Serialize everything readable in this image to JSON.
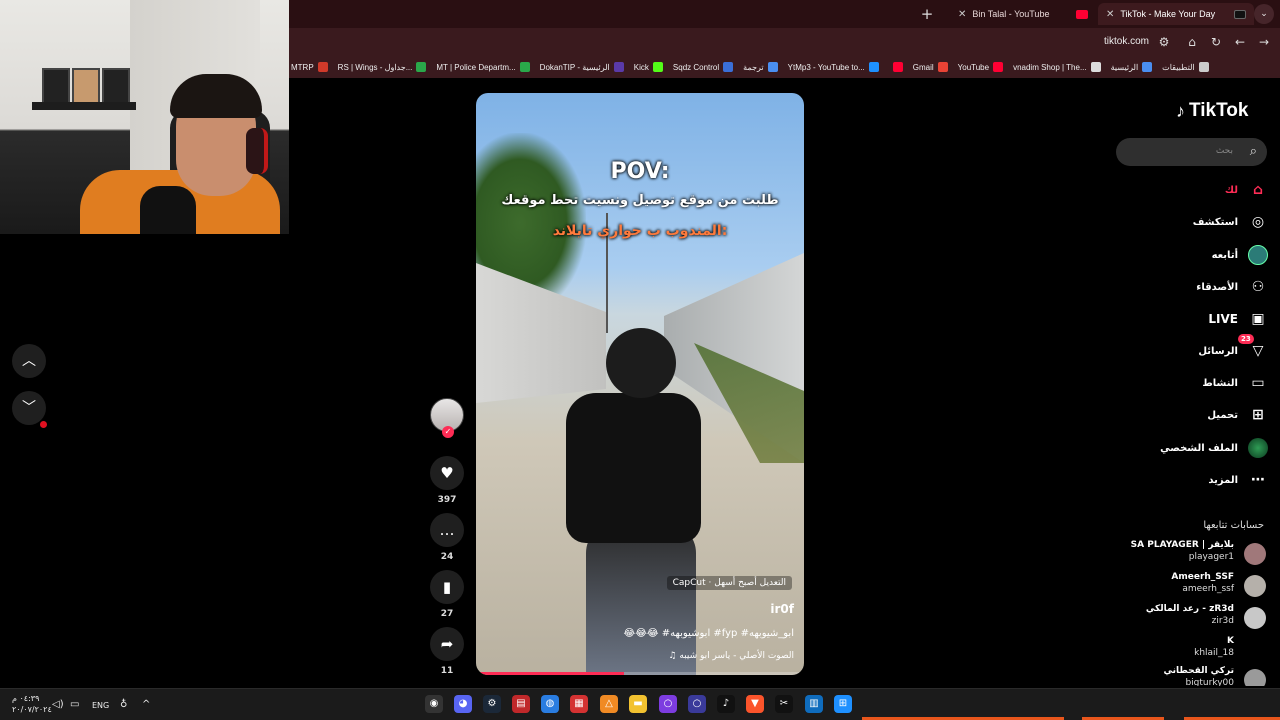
{
  "browser": {
    "tabs": [
      {
        "title": "Bin Talal - YouTube",
        "favicon": "youtube-icon"
      },
      {
        "title": "TikTok - Make Your Day",
        "favicon": "tiktok-icon",
        "active": true
      }
    ],
    "address": "tiktok.com",
    "bookmarks": [
      {
        "label": "MTRP",
        "color": "#d03a2a"
      },
      {
        "label": "RS | Wings - جداول...",
        "color": "#2aa84a"
      },
      {
        "label": "MT | Police Departm...",
        "color": "#2aa84a"
      },
      {
        "label": "DokanTIP - الرئيسية",
        "color": "#5a3aa8"
      },
      {
        "label": "Kick",
        "color": "#53fc18"
      },
      {
        "label": "Sqdz Control",
        "color": "#3a6fd8"
      },
      {
        "label": "ترجمة",
        "color": "#4a8ef0"
      },
      {
        "label": "YtMp3 - YouTube to...",
        "color": "#1e90ff"
      },
      {
        "label": "",
        "color": "#ff0033"
      },
      {
        "label": "Gmail",
        "color": "#ea4335"
      },
      {
        "label": "YouTube",
        "color": "#ff0033"
      },
      {
        "label": "vnadim Shop | The...",
        "color": "#dddddd"
      },
      {
        "label": "الرئيسية",
        "color": "#4a8ef0"
      },
      {
        "label": "التطبيقات",
        "color": "#cccccc"
      }
    ]
  },
  "video": {
    "overlay_pov": "POV:",
    "overlay_line1": "طلبت من موقع توصيل ونسيت تحط موقعك",
    "overlay_line2": "المندوب ب حواري تايلاند:",
    "capcut": "CapCut · التعديل أصبح أسهل",
    "author": "ir0f",
    "caption": "😂😂😂 #ابوشيوبهه #fyp #ابو_شيوبهه",
    "sound": "♫ الصوت الأصلي - ياسر ابو شيبه",
    "progress": 0.45
  },
  "actions": {
    "likes": "397",
    "comments": "24",
    "saves": "27",
    "shares": "11"
  },
  "sidebar": {
    "logo": "TikTok",
    "search_placeholder": "بحث",
    "nav": [
      {
        "label": "لك",
        "icon": "home-icon",
        "active": true
      },
      {
        "label": "استكشف",
        "icon": "compass-icon"
      },
      {
        "label": "أتابعه",
        "icon": "following-avatar-icon"
      },
      {
        "label": "الأصدقاء",
        "icon": "friends-icon"
      },
      {
        "label": "LIVE",
        "icon": "live-icon"
      },
      {
        "label": "الرسائل",
        "icon": "messages-icon",
        "badge": "23"
      },
      {
        "label": "النشاط",
        "icon": "activity-icon"
      },
      {
        "label": "تحميل",
        "icon": "upload-icon"
      },
      {
        "label": "الملف الشخصي",
        "icon": "profile-icon"
      },
      {
        "label": "المزيد",
        "icon": "more-icon"
      }
    ],
    "following_title": "حسابات تتابعها",
    "following": [
      {
        "name": "SA PLAYAGER | بلايقر",
        "user": "playager1"
      },
      {
        "name": "Ameerh_SSF",
        "user": "ameerh_ssf"
      },
      {
        "name": "رعد المالكي - zR3d",
        "user": "zir3d"
      },
      {
        "name": "K",
        "user": "khlail_18"
      },
      {
        "name": "تركي القحطاني",
        "user": "bigturky00"
      }
    ]
  },
  "taskbar": {
    "time": "٠٤:٣٩ م",
    "date": "٢٠/٠٧/٢٠٢٤",
    "lang": "ENG"
  }
}
